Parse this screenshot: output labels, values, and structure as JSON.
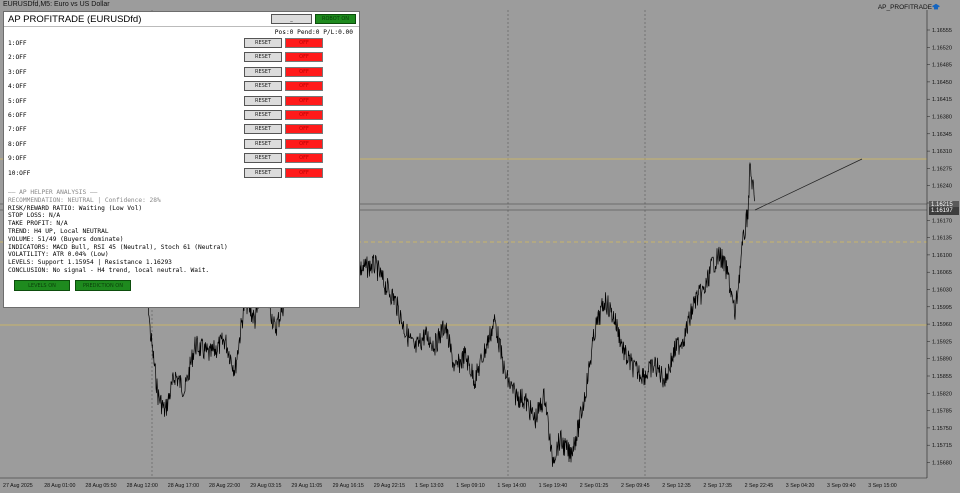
{
  "window": {
    "title": "EURUSDfd,M5:  Euro vs US Dollar",
    "indicator_name": "AP_PROFITRADE"
  },
  "panel": {
    "title": "AP PROFITRADE (EURUSDfd)",
    "minimize_label": "_",
    "robot_label": "ROBOT ON",
    "status": "Pos:0 Pend:0 P/L:0.00",
    "slots": [
      {
        "label": "1:OFF",
        "reset": "RESET",
        "toggle": "OFF"
      },
      {
        "label": "2:OFF",
        "reset": "RESET",
        "toggle": "OFF"
      },
      {
        "label": "3:OFF",
        "reset": "RESET",
        "toggle": "OFF"
      },
      {
        "label": "4:OFF",
        "reset": "RESET",
        "toggle": "OFF"
      },
      {
        "label": "5:OFF",
        "reset": "RESET",
        "toggle": "OFF"
      },
      {
        "label": "6:OFF",
        "reset": "RESET",
        "toggle": "OFF"
      },
      {
        "label": "7:OFF",
        "reset": "RESET",
        "toggle": "OFF"
      },
      {
        "label": "8:OFF",
        "reset": "RESET",
        "toggle": "OFF"
      },
      {
        "label": "9:OFF",
        "reset": "RESET",
        "toggle": "OFF"
      },
      {
        "label": "10:OFF",
        "reset": "RESET",
        "toggle": "OFF"
      }
    ],
    "analysis": {
      "header": "—— AP HELPER ANALYSIS ——",
      "recommendation": "RECOMMENDATION: NEUTRAL | Confidence: 28%",
      "risk_reward": "RISK/REWARD RATIO: Waiting (Low Vol)",
      "stop_loss": "STOP LOSS: N/A",
      "take_profit": "TAKE PROFIT: N/A",
      "trend": "TREND: H4 UP, Local NEUTRAL",
      "volume": "VOLUME: 51/49 (Buyers dominate)",
      "indicators": "INDICATORS: MACD Bull, RSI 45 (Neutral), Stoch 61 (Neutral)",
      "volatility": "VOLATILITY: ATR 0.04% (Low)",
      "levels": "LEVELS: Support 1.15954 | Resistance 1.16293",
      "conclusion": "CONCLUSION: No signal - H4 trend, local neutral. Wait."
    },
    "levels_button": "LEVELS ON",
    "prediction_button": "PREDICTION ON"
  },
  "price_axis": {
    "labels": [
      "1.16555",
      "1.16520",
      "1.16485",
      "1.16450",
      "1.16415",
      "1.16380",
      "1.16345",
      "1.16310",
      "1.16275",
      "1.16240",
      "1.16205",
      "1.16170",
      "1.16135",
      "1.16100",
      "1.16065",
      "1.16030",
      "1.15995",
      "1.15960",
      "1.15925",
      "1.15890",
      "1.15855",
      "1.15820",
      "1.15785",
      "1.15750",
      "1.15715",
      "1.15680"
    ],
    "current_price_1": "1.16215",
    "current_price_2": "1.16197"
  },
  "time_axis": {
    "labels": [
      "27 Aug 2025",
      "28 Aug 01:00",
      "28 Aug 05:50",
      "28 Aug 12:00",
      "28 Aug 17:00",
      "28 Aug 22:00",
      "29 Aug 03:15",
      "29 Aug 11:05",
      "29 Aug 16:15",
      "29 Aug 22:15",
      "1 Sep 13:03",
      "1 Sep 09:10",
      "1 Sep 14:00",
      "1 Sep 19:40",
      "2 Sep 01:25",
      "2 Sep 09:45",
      "2 Sep 12:35",
      "2 Sep 17:35",
      "2 Sep 22:45",
      "3 Sep 04:20",
      "3 Sep 09:40",
      "3 Sep 15:00"
    ]
  },
  "colors": {
    "chart_bg": "#9c9c9c",
    "candles": "#000000",
    "level_line": "#c8b46a",
    "toggle_off": "#ff1a1a",
    "robot_on": "#1e8a1e"
  }
}
